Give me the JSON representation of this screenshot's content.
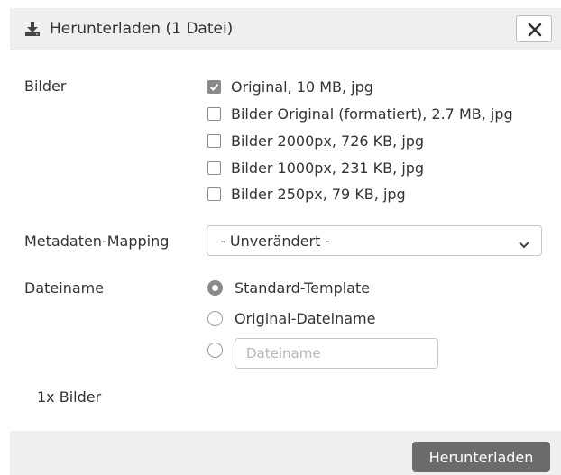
{
  "header": {
    "title": "Herunterladen (1 Datei)",
    "icon": "download-icon",
    "close_icon": "close-icon"
  },
  "images": {
    "label": "Bilder",
    "options": [
      {
        "label": "Original, 10 MB, jpg",
        "checked": true
      },
      {
        "label": "Bilder Original (formatiert), 2.7 MB, jpg",
        "checked": false
      },
      {
        "label": "Bilder 2000px, 726 KB, jpg",
        "checked": false
      },
      {
        "label": "Bilder 1000px, 231 KB, jpg",
        "checked": false
      },
      {
        "label": "Bilder 250px, 79 KB, jpg",
        "checked": false
      }
    ]
  },
  "metadata": {
    "label": "Metadaten-Mapping",
    "selected": "- Unverändert -"
  },
  "filename": {
    "label": "Dateiname",
    "options": [
      {
        "label": "Standard-Template",
        "checked": true
      },
      {
        "label": "Original-Dateiname",
        "checked": false
      }
    ],
    "custom_placeholder": "Dateiname",
    "custom_value": ""
  },
  "summary": "1x Bilder",
  "footer": {
    "download_label": "Herunterladen"
  },
  "colors": {
    "header_bg": "#efefef",
    "button_bg": "#6b6b6b",
    "checked_gray": "#8a8a8a"
  }
}
